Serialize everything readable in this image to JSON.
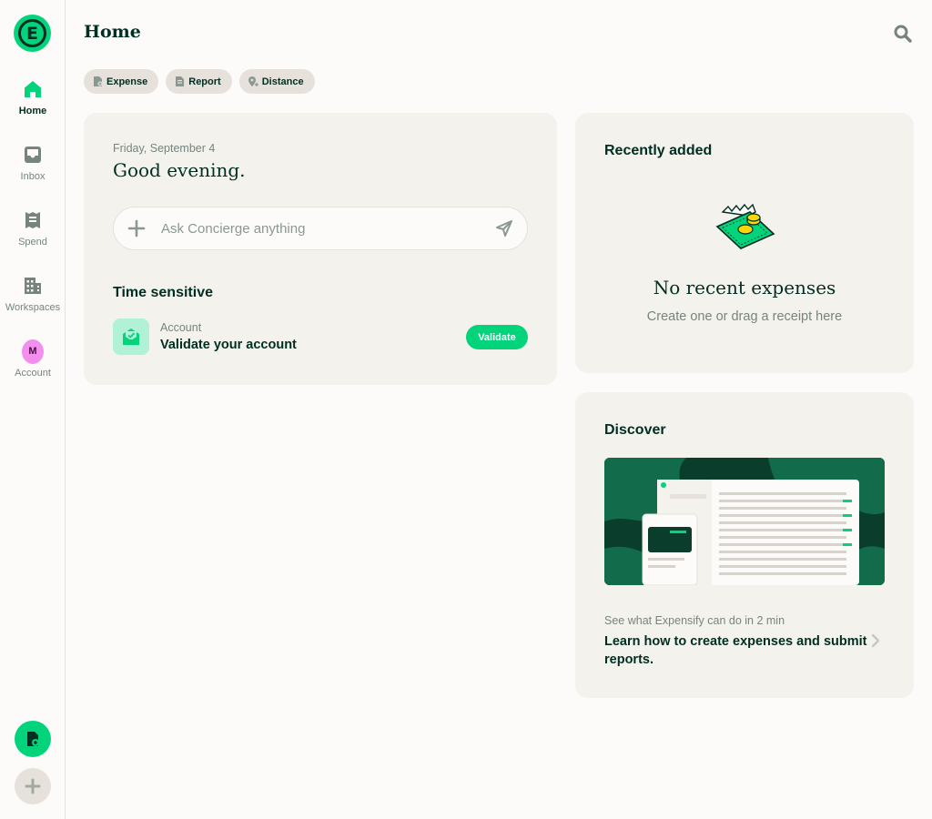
{
  "app": {
    "logo_letter": "E",
    "brand_color": "#03d47c",
    "text_color": "#002e22"
  },
  "sidebar": {
    "items": [
      {
        "label": "Home",
        "icon": "home-icon",
        "active": true
      },
      {
        "label": "Inbox",
        "icon": "inbox-icon"
      },
      {
        "label": "Spend",
        "icon": "receipt-icon"
      },
      {
        "label": "Workspaces",
        "icon": "building-icon"
      },
      {
        "label": "Account",
        "icon": "avatar",
        "avatar_initial": "M"
      }
    ],
    "fab_primary_icon": "new-expense-icon",
    "fab_secondary_icon": "plus-icon"
  },
  "header": {
    "title": "Home",
    "search_icon": "search-icon"
  },
  "quick_actions": [
    {
      "label": "Expense",
      "icon": "expense-icon"
    },
    {
      "label": "Report",
      "icon": "report-icon"
    },
    {
      "label": "Distance",
      "icon": "distance-icon"
    }
  ],
  "home_card": {
    "date": "Friday, September 4",
    "greeting": "Good evening.",
    "ask_placeholder": "Ask Concierge anything",
    "time_sensitive": {
      "title": "Time sensitive",
      "item_category": "Account",
      "item_title": "Validate your account",
      "action_label": "Validate",
      "icon": "validate-account-icon"
    }
  },
  "recently_added": {
    "title": "Recently added",
    "empty_title": "No recent expenses",
    "empty_subtitle": "Create one or drag a receipt here",
    "illustration": "money-receipt-illustration"
  },
  "discover": {
    "title": "Discover",
    "image": "product-tour-screenshot",
    "subtitle": "See what Expensify can do in 2 min",
    "link_text": "Learn how to create expenses and submit reports."
  }
}
